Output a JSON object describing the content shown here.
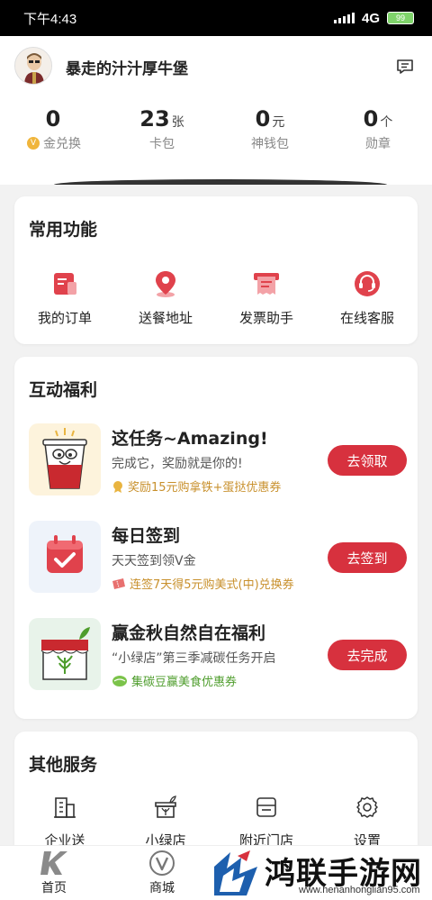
{
  "status_bar": {
    "time": "下午4:43",
    "network": "4G",
    "battery": "99"
  },
  "profile": {
    "username": "暴走的汁汁厚牛堡"
  },
  "stats": [
    {
      "value": "0",
      "unit": "",
      "label": "金兑换",
      "coin_glyph": "V"
    },
    {
      "value": "23",
      "unit": "张",
      "label": "卡包"
    },
    {
      "value": "0",
      "unit": "元",
      "label": "神钱包"
    },
    {
      "value": "0",
      "unit": "个",
      "label": "勋章"
    }
  ],
  "common_functions": {
    "title": "常用功能",
    "items": [
      {
        "label": "我的订单",
        "icon": "order-icon"
      },
      {
        "label": "送餐地址",
        "icon": "location-icon"
      },
      {
        "label": "发票助手",
        "icon": "invoice-icon"
      },
      {
        "label": "在线客服",
        "icon": "customer-service-icon"
      }
    ]
  },
  "benefits": {
    "title": "互动福利",
    "tasks": [
      {
        "title": "这任务~Amazing!",
        "desc": "完成它，奖励就是你的!",
        "reward": "奖励15元购拿铁+蛋挞优惠券",
        "button": "去领取"
      },
      {
        "title": "每日签到",
        "desc": "天天签到领V金",
        "reward": "连签7天得5元购美式(中)兑换券",
        "button": "去签到"
      },
      {
        "title": "赢金秋自然自在福利",
        "desc": "“小绿店”第三季减碳任务开启",
        "reward": "集碳豆赢美食优惠券",
        "button": "去完成"
      }
    ]
  },
  "other_services": {
    "title": "其他服务",
    "items": [
      {
        "label": "企业送",
        "icon": "building-icon"
      },
      {
        "label": "小绿店",
        "icon": "green-store-icon"
      },
      {
        "label": "附近门店",
        "icon": "store-icon"
      },
      {
        "label": "设置",
        "icon": "settings-icon"
      }
    ]
  },
  "tabbar": {
    "items": [
      {
        "label": "首页",
        "icon": "home-k-icon"
      },
      {
        "label": "商城",
        "icon": "mall-v-icon"
      }
    ]
  },
  "watermark": {
    "text": "鸿联手游网",
    "url": "www.henanhonglian95.com"
  },
  "colors": {
    "accent": "#d7313e",
    "reward_gold": "#c8902c",
    "reward_green": "#4e9d2c"
  }
}
